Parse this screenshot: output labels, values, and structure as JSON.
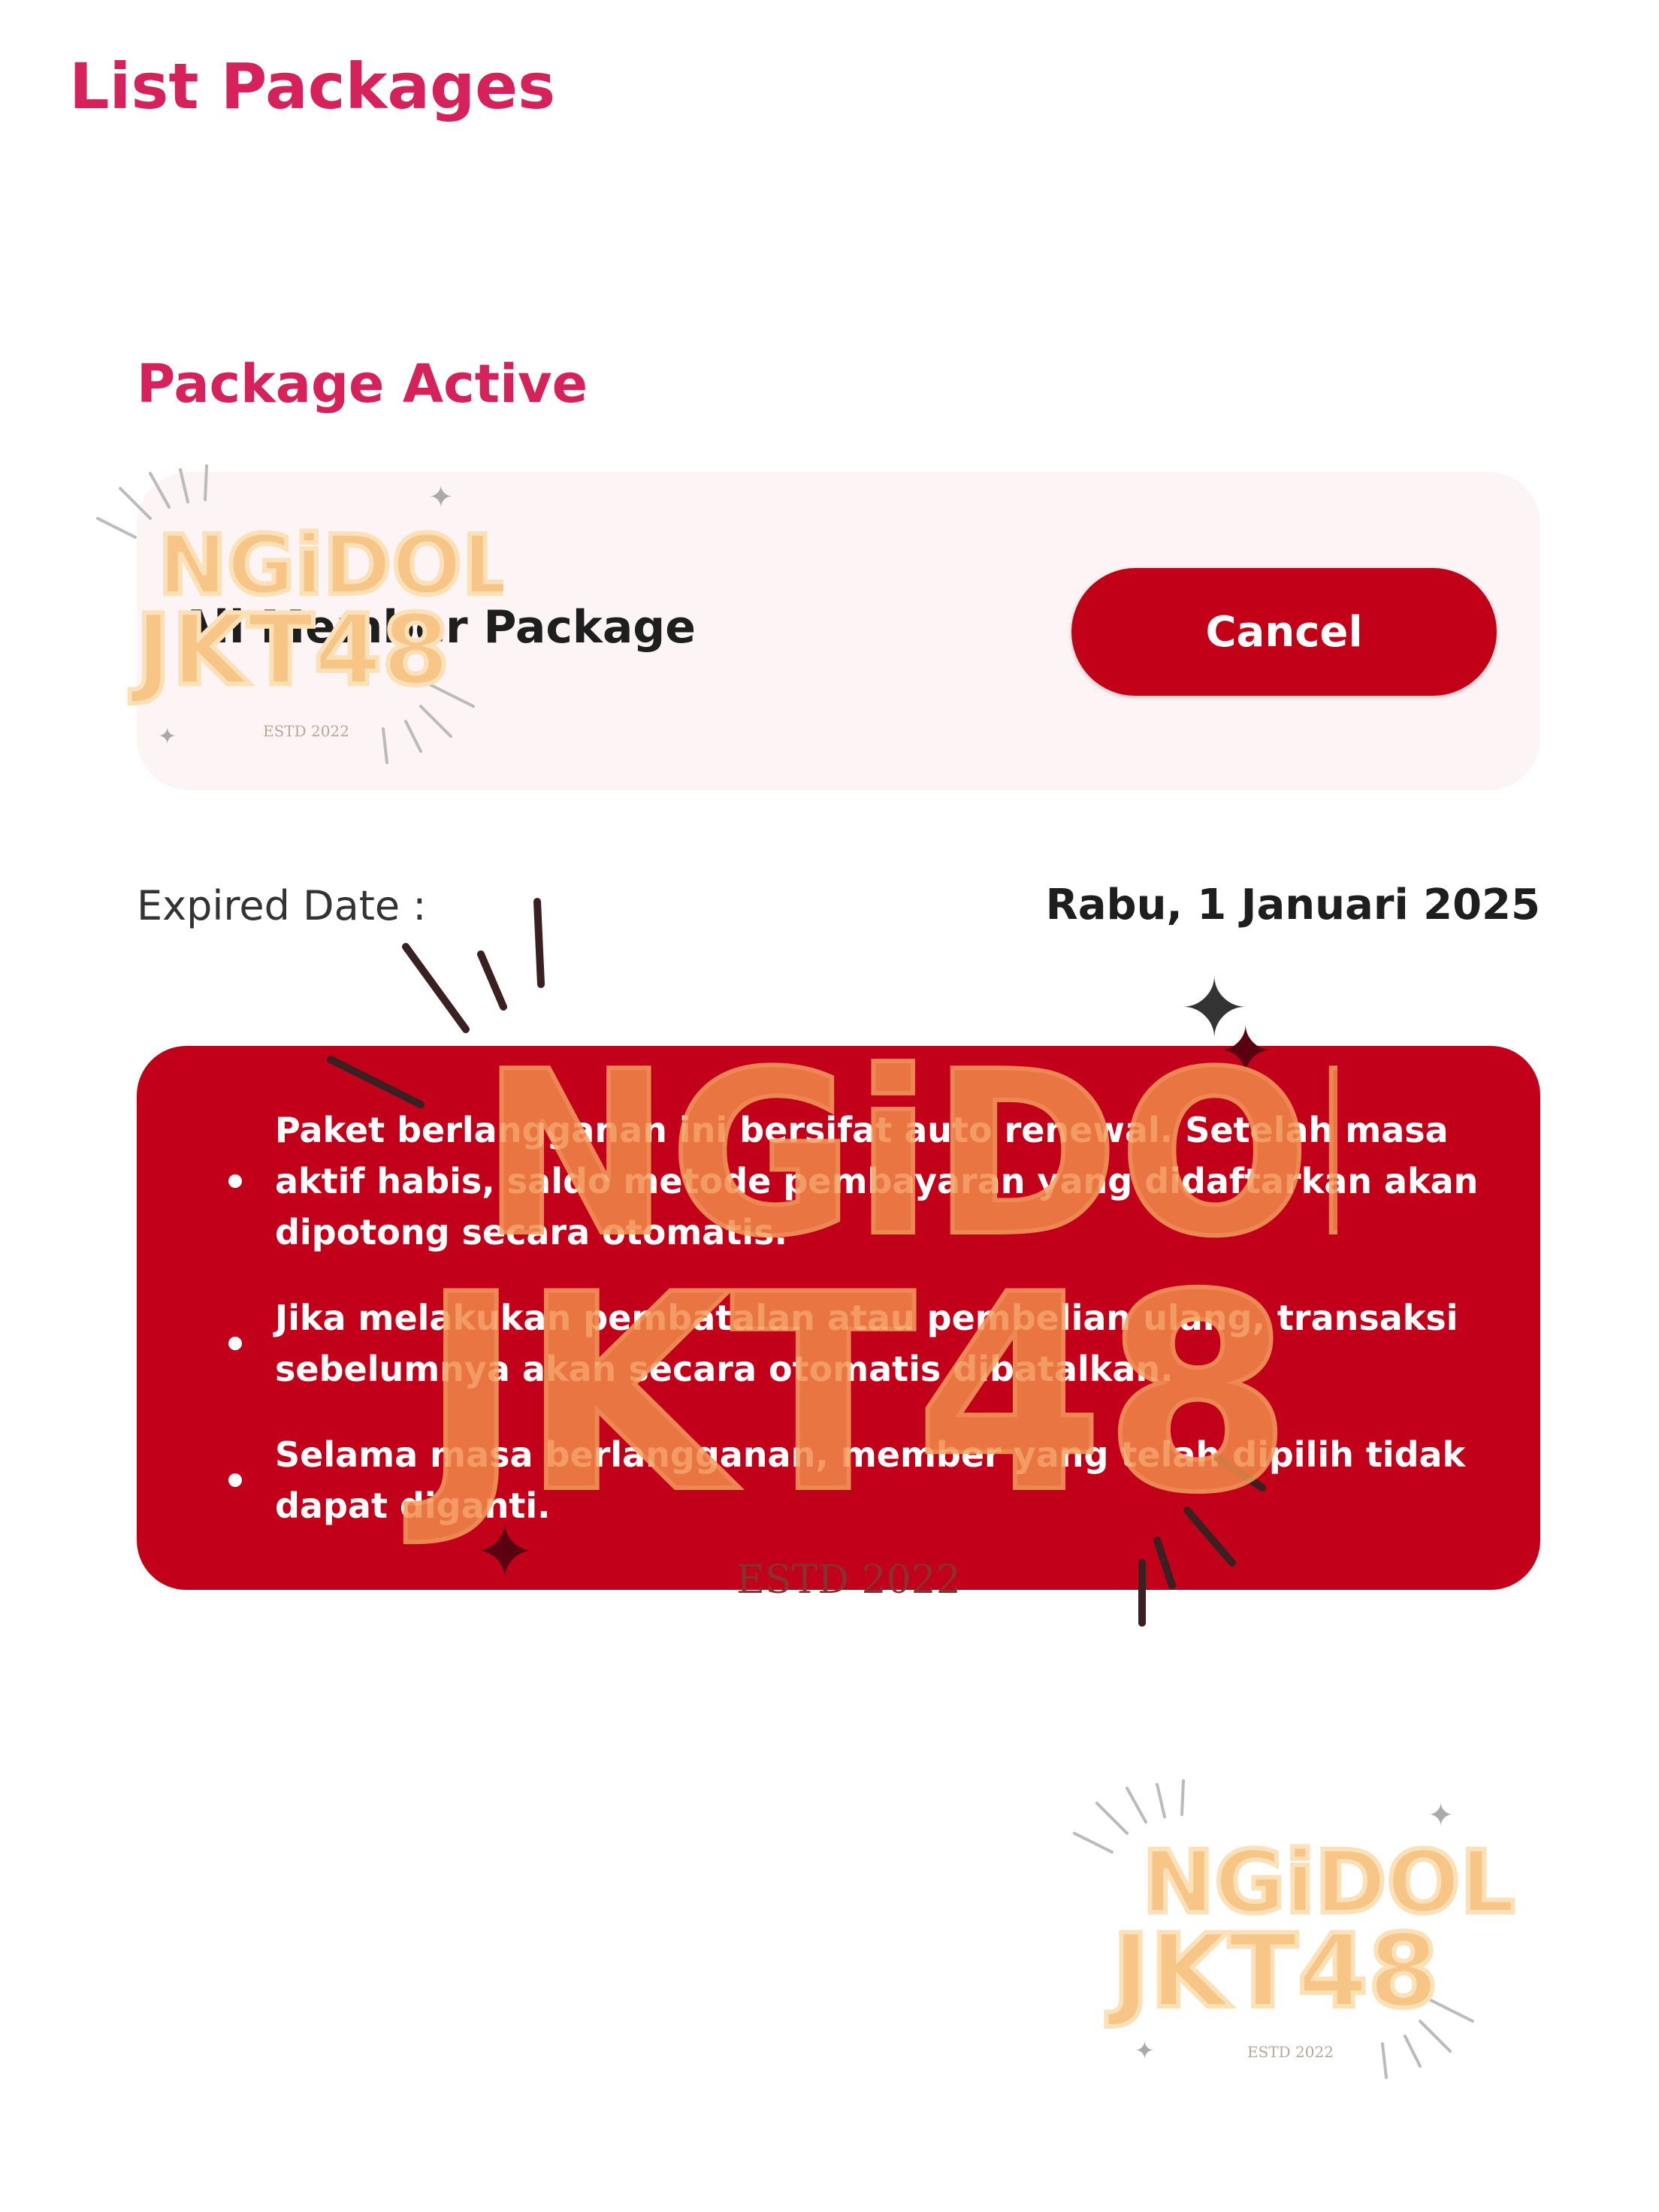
{
  "header": {
    "title": "List Packages"
  },
  "active_package": {
    "section_title": "Package Active",
    "name": "All Member Package",
    "cancel_label": "Cancel",
    "expired_label": "Expired Date :",
    "expired_value": "Rabu, 1 Januari 2025"
  },
  "info": {
    "items": [
      "Paket berlangganan ini bersifat auto renewal. Setelah masa aktif habis, saldo metode pembayaran yang didaftarkan akan dipotong secara otomatis.",
      "Jika melakukan pembatalan atau pembelian ulang, transaksi sebelumnya akan secara otomatis dibatalkan.",
      "Selama masa berlangganan, member yang telah dipilih tidak dapat diganti."
    ]
  },
  "watermark": {
    "line1": "NGiDOL",
    "line2": "JKT48",
    "estd": "ESTD 2022"
  },
  "colors": {
    "accent": "#d6225a",
    "brand_red": "#c3001a",
    "card_bg": "#fdf5f5",
    "watermark": "#f7c585"
  }
}
